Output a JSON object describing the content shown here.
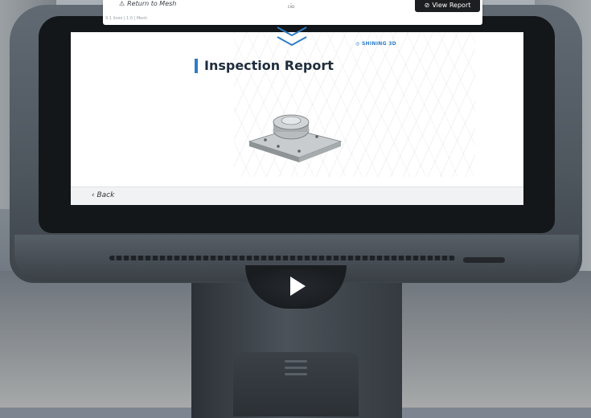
{
  "top_bar": {
    "return_label": "Return to Mesh",
    "cad_label": "CAD",
    "view_report_label": "View Report",
    "meta_text": "9.1 lines | 1.0 | Mesh"
  },
  "screen": {
    "brand": "SHINING 3D",
    "title": "Inspection Report",
    "back_label": "Back"
  },
  "colors": {
    "accent": "#2d7dc8",
    "view_report_bg": "#1c1e21"
  }
}
